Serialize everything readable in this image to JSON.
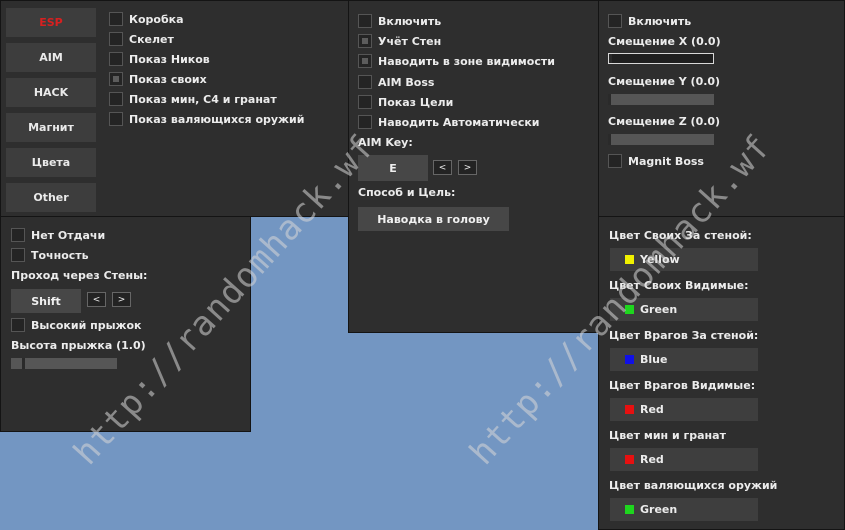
{
  "nav": [
    {
      "label": "ESP",
      "active": true
    },
    {
      "label": "AIM",
      "active": false
    },
    {
      "label": "HACK",
      "active": false
    },
    {
      "label": "Магнит",
      "active": false
    },
    {
      "label": "Цвета",
      "active": false
    },
    {
      "label": "Other",
      "active": false
    }
  ],
  "esp": {
    "box": "Коробка",
    "skeleton": "Скелет",
    "show_nicks": "Показ Ников",
    "show_own": "Показ своих",
    "show_mines": "Показ мин, C4 и гранат",
    "show_weapons": "Показ валяющихся оружий",
    "show_own_checked": true
  },
  "aim": {
    "enable": "Включить",
    "walls": "Учёт Стен",
    "fov": "Наводить в зоне видимости",
    "boss": "AIM Boss",
    "show_target": "Показ Цели",
    "auto": "Наводить Автоматически",
    "walls_checked": true,
    "fov_checked": true,
    "key_label": "AIM Key:",
    "key_value": "E",
    "prev": "<",
    "next": ">",
    "method_label": "Способ и Цель:",
    "method_value": "Наводка в голову"
  },
  "magnet": {
    "enable": "Включить",
    "offset_x": "Смещение X (0.0)",
    "offset_y": "Смещение Y (0.0)",
    "offset_z": "Смещение Z (0.0)",
    "boss": "Magnit Boss",
    "offset_x_value": 0.0,
    "offset_y_value": 0.0,
    "offset_z_value": 0.0
  },
  "hack": {
    "no_recoil": "Нет Отдачи",
    "accuracy": "Точность",
    "wallhack_label": "Проход через Стены:",
    "wallhack_key": "Shift",
    "prev": "<",
    "next": ">",
    "high_jump": "Высокий прыжок",
    "jump_height": "Высота прыжка (1.0)",
    "jump_height_value": 1.0
  },
  "colors": [
    {
      "label": "Цвет Своих За стеной:",
      "value": "Yellow",
      "hex": "#f2f200"
    },
    {
      "label": "Цвет Своих Видимые:",
      "value": "Green",
      "hex": "#1ed61e"
    },
    {
      "label": "Цвет Врагов За стеной:",
      "value": "Blue",
      "hex": "#1010e6"
    },
    {
      "label": "Цвет Врагов Видимые:",
      "value": "Red",
      "hex": "#e61010"
    },
    {
      "label": "Цвет мин и гранат",
      "value": "Red",
      "hex": "#e61010"
    },
    {
      "label": "Цвет валяющихся оружий",
      "value": "Green",
      "hex": "#1ed61e"
    }
  ],
  "watermark": "http://randomhack.wf"
}
